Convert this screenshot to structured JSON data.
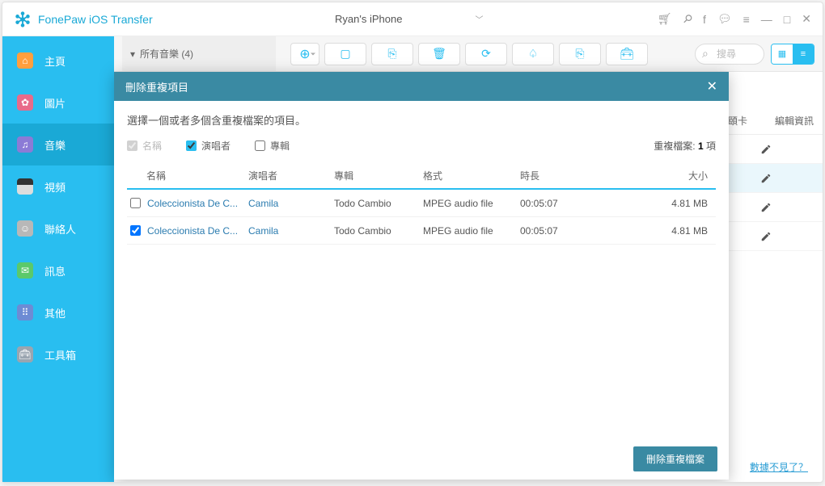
{
  "app": {
    "title": "FonePaw iOS Transfer"
  },
  "device": {
    "name": "Ryan's iPhone"
  },
  "sidebar": {
    "items": [
      {
        "label": "主頁"
      },
      {
        "label": "圖片"
      },
      {
        "label": "音樂"
      },
      {
        "label": "視頻"
      },
      {
        "label": "聯絡人"
      },
      {
        "label": "訊息"
      },
      {
        "label": "其他"
      },
      {
        "label": "工具箱"
      }
    ]
  },
  "subheader": {
    "title": "所有音樂 (4)"
  },
  "search": {
    "placeholder": "搜尋"
  },
  "bg_headers": {
    "card": "頤卡",
    "edit": "編輯資訊"
  },
  "modal": {
    "title": "刪除重複項目",
    "instruction": "選擇一個或者多個含重複檔案的項目。",
    "filters": {
      "name": "名稱",
      "artist": "演唱者",
      "album": "專輯"
    },
    "dup_label_pre": "重複檔案: ",
    "dup_count": "1",
    "dup_label_post": " 項",
    "headers": {
      "name": "名稱",
      "artist": "演唱者",
      "album": "專輯",
      "format": "格式",
      "duration": "時長",
      "size": "大小"
    },
    "rows": [
      {
        "checked": false,
        "name": "Coleccionista De C...",
        "artist": "Camila",
        "album": "Todo Cambio",
        "format": "MPEG audio file",
        "duration": "00:05:07",
        "size": "4.81 MB"
      },
      {
        "checked": true,
        "name": "Coleccionista De C...",
        "artist": "Camila",
        "album": "Todo Cambio",
        "format": "MPEG audio file",
        "duration": "00:05:07",
        "size": "4.81 MB"
      }
    ],
    "delete_btn": "刪除重複檔案"
  },
  "footer": {
    "help_link": "數據不見了？"
  }
}
